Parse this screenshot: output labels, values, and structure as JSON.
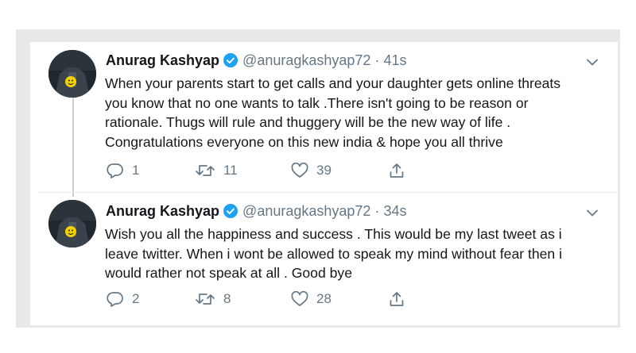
{
  "tweets": [
    {
      "author": "Anurag Kashyap",
      "handle": "@anuragkashyap72",
      "separator": "·",
      "time": "41s",
      "lines": [
        "When your parents start to get calls and your daughter gets online threats",
        "you know that no one wants to talk .There isn't going to be reason or",
        "rationale. Thugs will rule and thuggery will be the new way of life .",
        "Congratulations everyone on this new india & hope you all thrive"
      ],
      "replies": "1",
      "retweets": "11",
      "likes": "39"
    },
    {
      "author": "Anurag Kashyap",
      "handle": "@anuragkashyap72",
      "separator": "·",
      "time": "34s",
      "lines": [
        "Wish you all the happiness and success . This would be my last tweet as i",
        "leave twitter. When i wont be allowed to speak my mind without fear then i",
        "would rather not speak at all . Good bye"
      ],
      "replies": "2",
      "retweets": "8",
      "likes": "28"
    }
  ],
  "colors": {
    "verified_badge": "#1da1f2",
    "text": "#14171a",
    "muted": "#657786",
    "frame": "#e7e8ea"
  },
  "icons": [
    "avatar",
    "verified-badge-icon",
    "chevron-down-icon",
    "reply-icon",
    "retweet-icon",
    "like-icon",
    "share-icon"
  ]
}
